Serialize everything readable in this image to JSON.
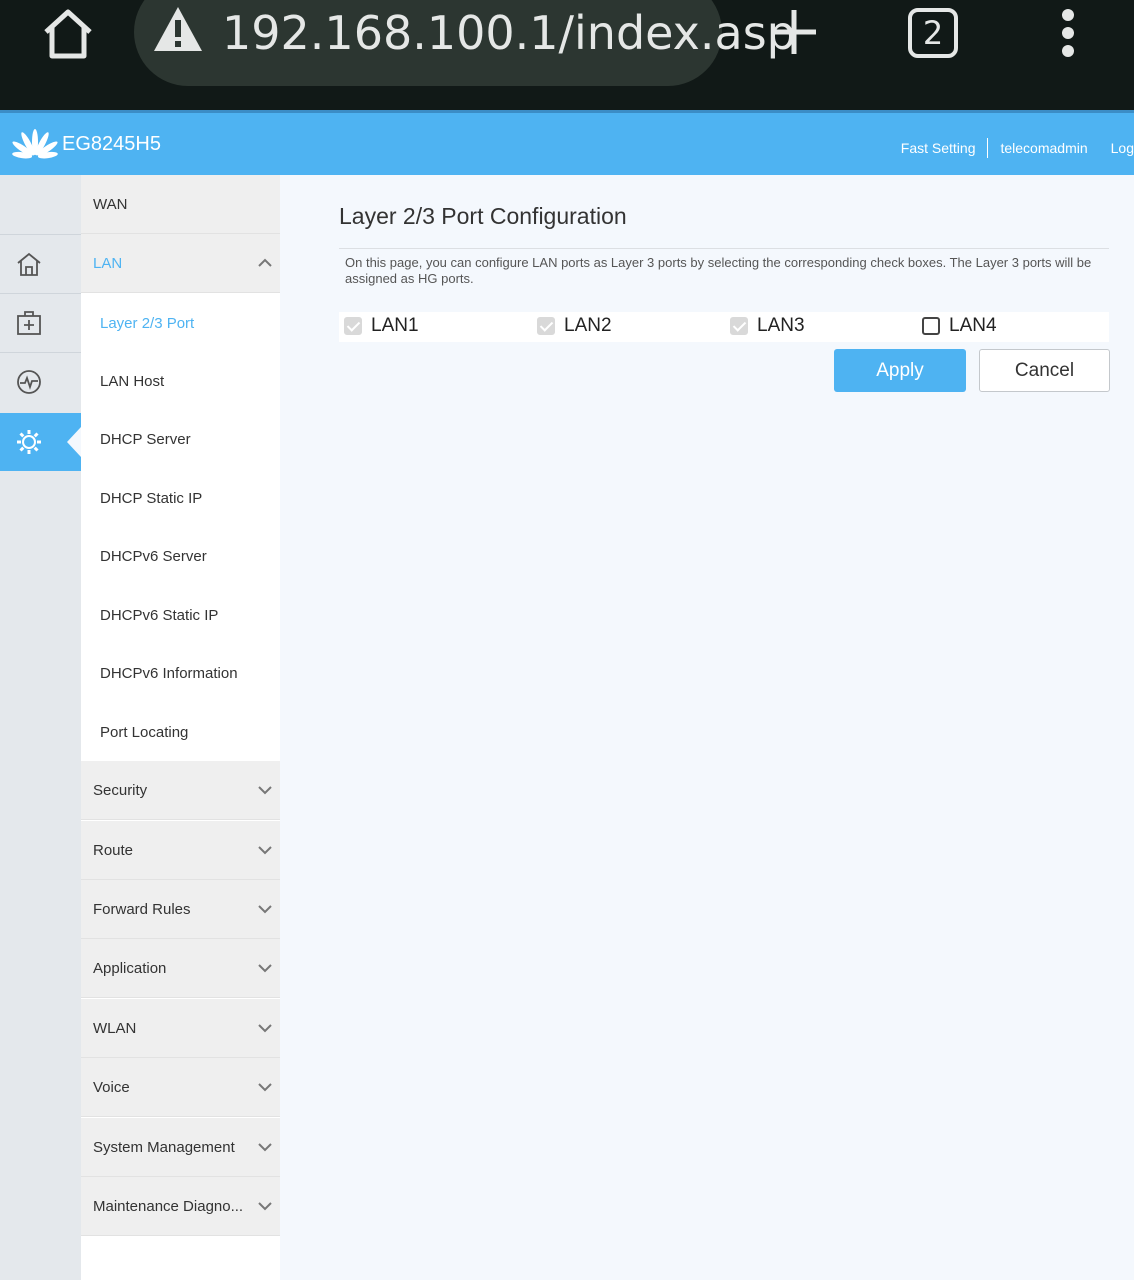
{
  "browser": {
    "url": "192.168.100.1/index.asp",
    "tab_count": "2",
    "icons": [
      "home-icon",
      "warning-icon",
      "plus-icon",
      "tabs-icon",
      "more-vert-icon"
    ]
  },
  "header": {
    "model": "EG8245H5",
    "links": [
      "Fast Setting",
      "telecomadmin",
      "Log"
    ]
  },
  "rail": {
    "icons": [
      "home-icon",
      "add-box-icon",
      "pulse-icon",
      "gear-icon"
    ]
  },
  "menu": {
    "wan": "WAN",
    "lan": "LAN",
    "lan_items": [
      "Layer 2/3 Port",
      "LAN Host",
      "DHCP Server",
      "DHCP Static IP",
      "DHCPv6 Server",
      "DHCPv6 Static IP",
      "DHCPv6 Information",
      "Port Locating"
    ],
    "groups": [
      "Security",
      "Route",
      "Forward Rules",
      "Application",
      "WLAN",
      "Voice",
      "System Management",
      "Maintenance Diagno..."
    ]
  },
  "content": {
    "title": "Layer 2/3 Port Configuration",
    "description": "On this page, you can configure LAN ports as Layer 3 ports by selecting the corresponding check boxes. The Layer 3 ports will be assigned as HG ports.",
    "ports": [
      {
        "label": "LAN1",
        "state": "checked-disabled"
      },
      {
        "label": "LAN2",
        "state": "checked-disabled"
      },
      {
        "label": "LAN3",
        "state": "checked-disabled"
      },
      {
        "label": "LAN4",
        "state": "unchecked"
      }
    ],
    "apply_label": "Apply",
    "cancel_label": "Cancel"
  },
  "colors": {
    "accent": "#4eb3f2",
    "chrome_bg": "#111917",
    "content_bg": "#f4f8fd"
  }
}
